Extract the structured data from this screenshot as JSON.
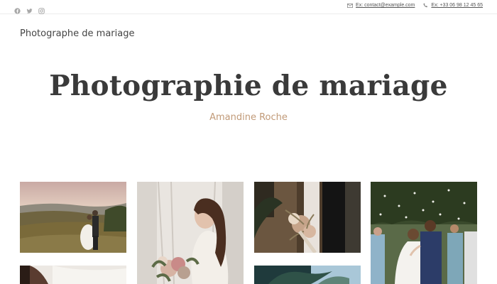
{
  "topbar": {
    "social_icons": [
      "facebook-icon",
      "twitter-icon",
      "instagram-icon"
    ],
    "email": "Ex: contact@example.com",
    "phone": "Ex: +33 06 98 12 45 65"
  },
  "header": {
    "site_title": "Photographe de mariage"
  },
  "hero": {
    "title": "Photographie de mariage",
    "subtitle": "Amandine Roche",
    "subtitle_color": "#c19a78"
  },
  "gallery": {
    "photos": [
      "couple-on-hill",
      "bride-with-bouquet",
      "bouquet-closeup",
      "confetti-kiss",
      "bride-dress",
      "palm-tree"
    ]
  }
}
